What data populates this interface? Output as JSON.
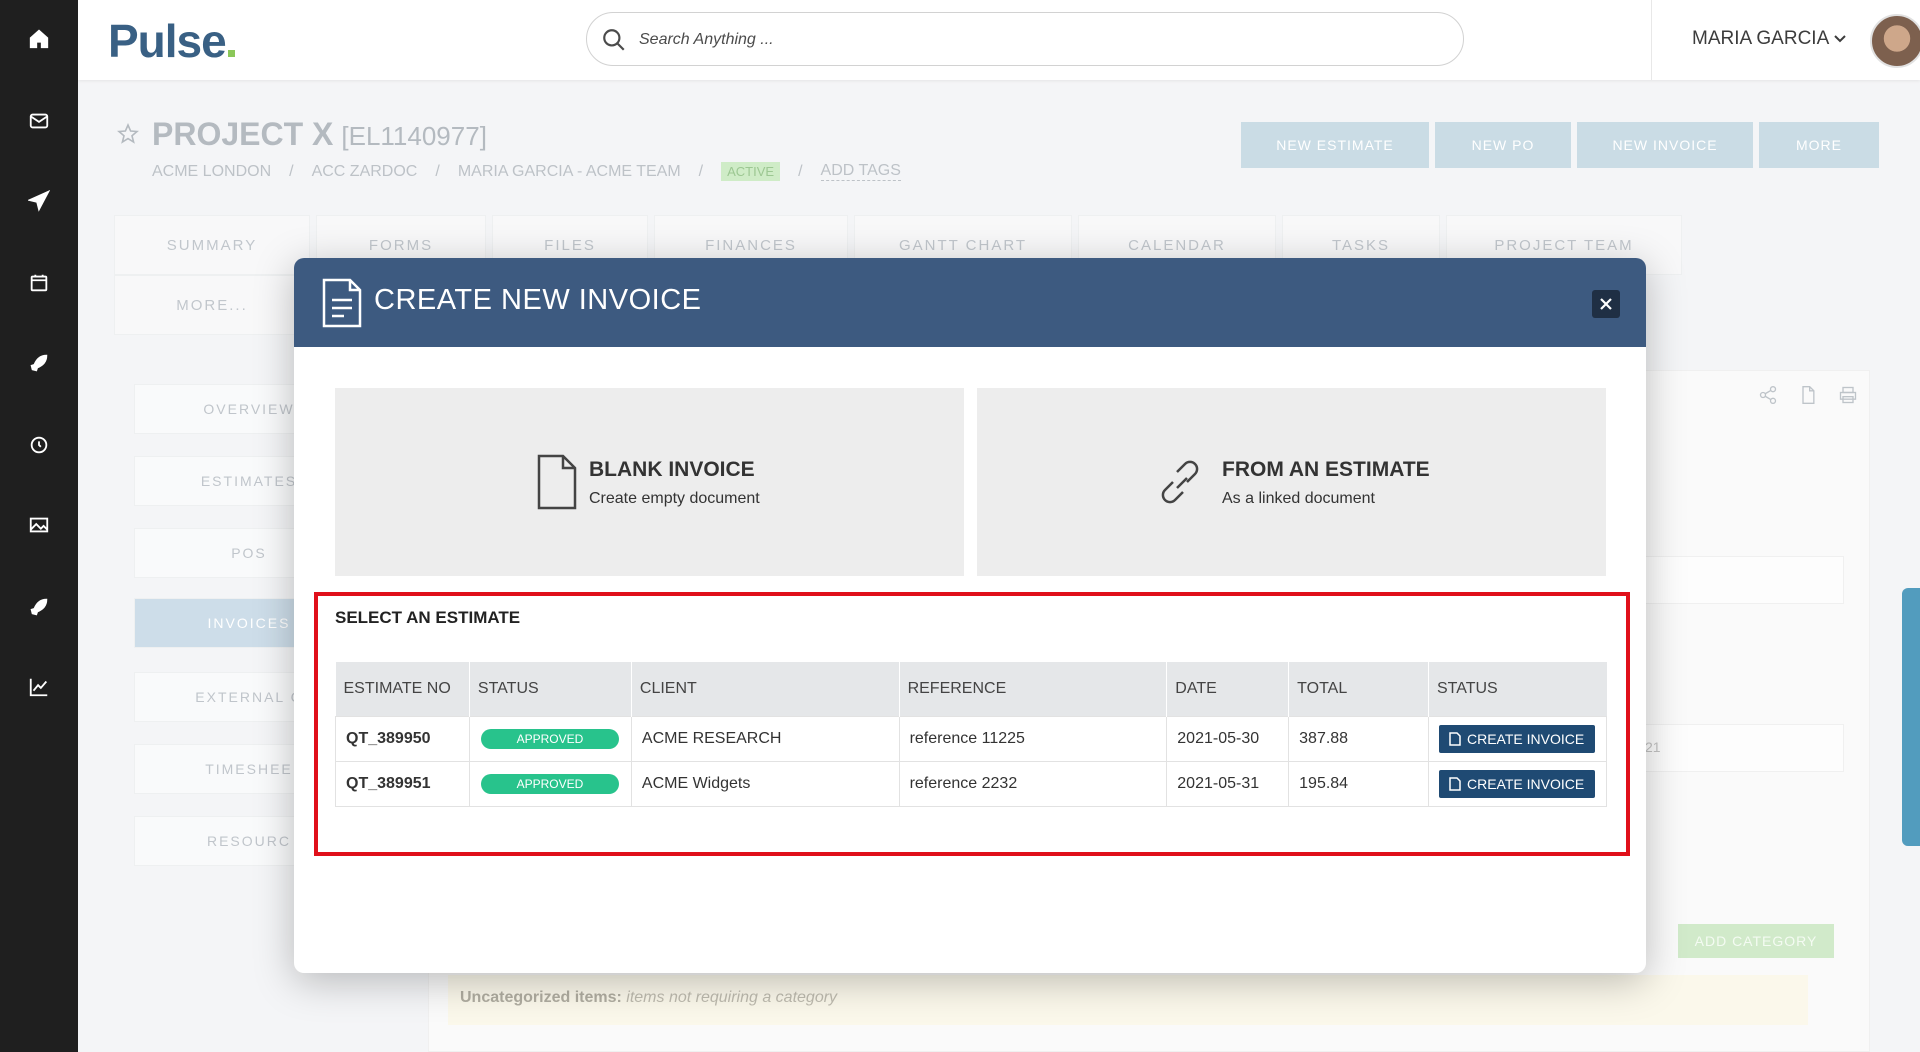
{
  "header": {
    "logo": "Pulse",
    "search_placeholder": "Search Anything ...",
    "user_name": "MARIA GARCIA"
  },
  "rail_icons": [
    "home-icon",
    "mail-icon",
    "send-icon",
    "calendar-icon",
    "rocket-icon",
    "clock-icon",
    "image-icon",
    "rocket-icon",
    "chart-icon"
  ],
  "project": {
    "title": "PROJECT X",
    "code": "[EL1140977]",
    "breadcrumbs": [
      "ACME LONDON",
      "ACC ZARDOC",
      "MARIA GARCIA - ACME TEAM"
    ],
    "status": "ACTIVE",
    "add_tags": "ADD TAGS",
    "buttons": [
      "NEW ESTIMATE",
      "NEW PO",
      "NEW INVOICE",
      "MORE"
    ],
    "tabs": [
      "SUMMARY",
      "FORMS",
      "FILES",
      "FINANCES",
      "GANTT CHART",
      "CALENDAR",
      "TASKS",
      "PROJECT TEAM",
      "MORE..."
    ],
    "side_items": [
      "OVERVIEW",
      "ESTIMATES",
      "POS",
      "INVOICES",
      "EXTERNAL C",
      "TIMESHEE",
      "RESOURC"
    ],
    "add_category": "ADD CATEGORY",
    "uncategorized_label": "Uncategorized items:",
    "uncategorized_text": "items not requiring a category",
    "bg_field_fragment": "21"
  },
  "modal": {
    "title": "CREATE NEW INVOICE",
    "blank": {
      "title": "BLANK INVOICE",
      "subtitle": "Create empty document"
    },
    "from_estimate": {
      "title": "FROM AN ESTIMATE",
      "subtitle": "As a linked document"
    },
    "select_title": "SELECT AN ESTIMATE",
    "columns": [
      "ESTIMATE NO",
      "STATUS",
      "CLIENT",
      "REFERENCE",
      "DATE",
      "TOTAL",
      "STATUS"
    ],
    "rows": [
      {
        "no": "QT_389950",
        "status": "APPROVED",
        "client": "ACME RESEARCH",
        "reference": "reference 11225",
        "date": "2021-05-30",
        "total": "387.88",
        "action": "CREATE INVOICE"
      },
      {
        "no": "QT_389951",
        "status": "APPROVED",
        "client": "ACME Widgets",
        "reference": "reference 2232",
        "date": "2021-05-31",
        "total": "195.84",
        "action": "CREATE INVOICE"
      }
    ]
  },
  "colors": {
    "brand": "#1e4a73",
    "modal_header": "#3d5a80",
    "approved": "#28c38c",
    "highlight": "#e0101a"
  }
}
